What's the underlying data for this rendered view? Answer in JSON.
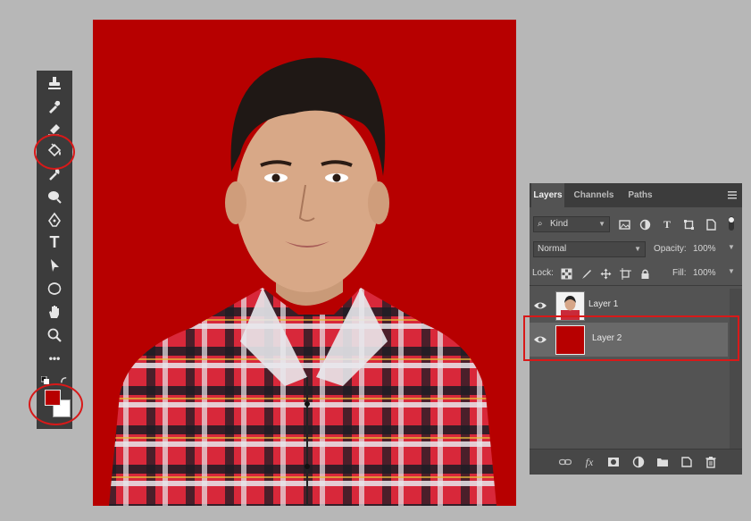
{
  "colors": {
    "canvas_background": "#b70000",
    "foreground_swatch": "#b70000",
    "background_swatch": "#ffffff",
    "annotation": "#d81919"
  },
  "toolbar": {
    "tools": [
      {
        "icon": "clone-stamp-icon"
      },
      {
        "icon": "history-brush-icon"
      },
      {
        "icon": "eraser-icon"
      },
      {
        "icon": "paint-bucket-icon",
        "highlighted": true
      },
      {
        "icon": "smudge-icon"
      },
      {
        "icon": "dodge-icon"
      },
      {
        "icon": "pen-icon"
      },
      {
        "icon": "type-icon",
        "glyph": "T"
      },
      {
        "icon": "path-selection-icon"
      },
      {
        "icon": "custom-shape-icon"
      },
      {
        "icon": "hand-icon"
      },
      {
        "icon": "zoom-icon"
      },
      {
        "icon": "more-tools-icon",
        "glyph": "•••"
      }
    ]
  },
  "layers_panel": {
    "tabs": [
      "Layers",
      "Channels",
      "Paths"
    ],
    "active_tab": "Layers",
    "filter": {
      "label": "Kind"
    },
    "blend_mode": "Normal",
    "opacity_label": "Opacity:",
    "opacity_value": "100%",
    "lock_label": "Lock:",
    "fill_label": "Fill:",
    "fill_value": "100%",
    "layers": [
      {
        "name": "Layer 1",
        "visible": true,
        "selected": false,
        "thumbnail": "photo"
      },
      {
        "name": "Layer 2",
        "visible": true,
        "selected": true,
        "thumbnail": "#b70000"
      }
    ],
    "bottom_icons": [
      "link-icon",
      "fx-icon",
      "add-mask-icon",
      "adjustment-layer-icon",
      "new-group-icon",
      "new-layer-icon",
      "trash-icon"
    ],
    "fx_text": "fx"
  }
}
